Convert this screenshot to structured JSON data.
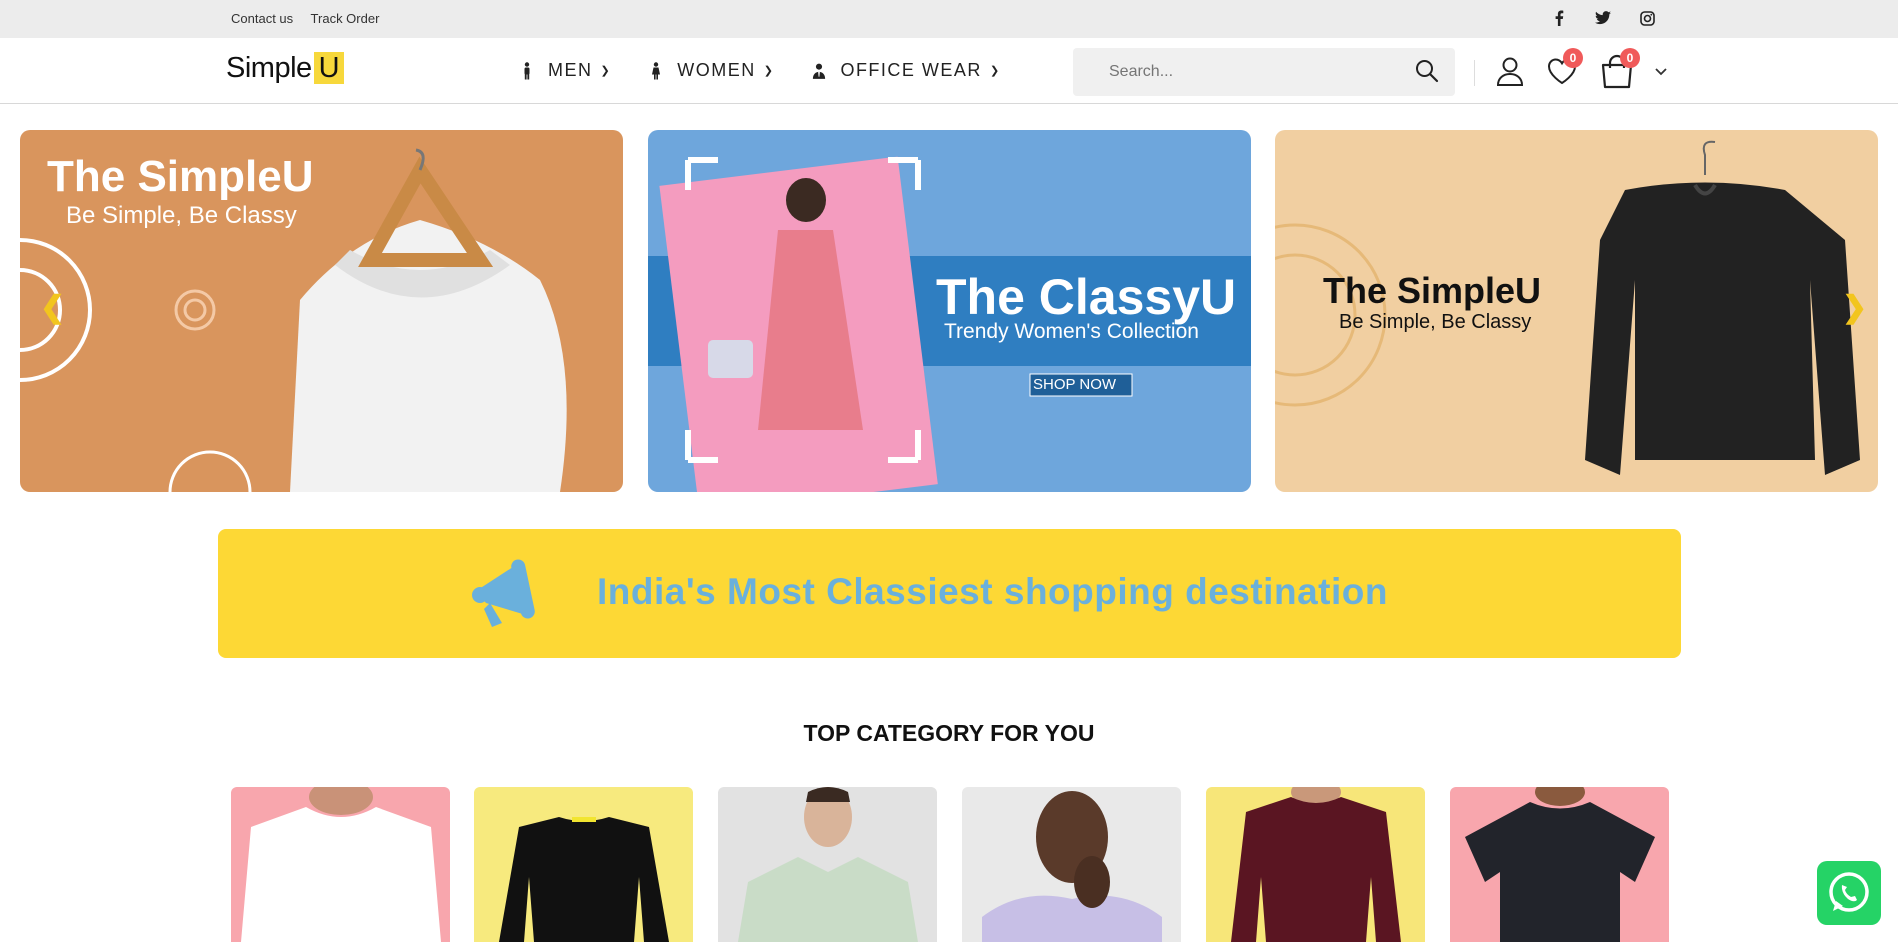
{
  "topbar": {
    "links": [
      "Contact us",
      "Track Order"
    ],
    "social_icons": [
      "facebook-icon",
      "twitter-icon",
      "instagram-icon"
    ]
  },
  "header": {
    "logo_text": "Simple",
    "logo_highlight": "U",
    "menu": [
      {
        "label": "MEN",
        "icon": "man-icon"
      },
      {
        "label": "WOMEN",
        "icon": "woman-icon"
      },
      {
        "label": "OFFICE WEAR",
        "icon": "office-person-icon"
      }
    ],
    "search_placeholder": "Search...",
    "wishlist_count": "0",
    "cart_count": "0"
  },
  "banners": [
    {
      "title": "The SimpleU",
      "subtitle": "Be Simple, Be Classy",
      "bg": "#d9955d"
    },
    {
      "title": "The ClassyU",
      "subtitle": "Trendy Women's Collection",
      "cta": "SHOP NOW",
      "bg": "#6ea6dc"
    },
    {
      "title": "The SimpleU",
      "subtitle": "Be Simple, Be Classy",
      "bg": "#f1cfa1"
    }
  ],
  "promo": {
    "text": "India's Most Classiest shopping destination",
    "bg": "#fdd835",
    "text_color": "#6ab0dc"
  },
  "categories_section": {
    "title": "TOP CATEGORY FOR YOU",
    "items": [
      {
        "bg": "#f8a6ad",
        "shirt": "#ffffff"
      },
      {
        "bg": "#f7ea7e",
        "shirt": "#111111"
      },
      {
        "bg": "#e2e2e2",
        "shirt": "#c9dcc7"
      },
      {
        "bg": "#e9e9e9",
        "shirt": "#c7bfe6"
      },
      {
        "bg": "#f7e679",
        "shirt": "#5a1522"
      },
      {
        "bg": "#f8a6ad",
        "shirt": "#22242b"
      }
    ]
  },
  "colors": {
    "accent": "#f7d83b",
    "badge": "#f05a5a",
    "whatsapp": "#25d366"
  }
}
